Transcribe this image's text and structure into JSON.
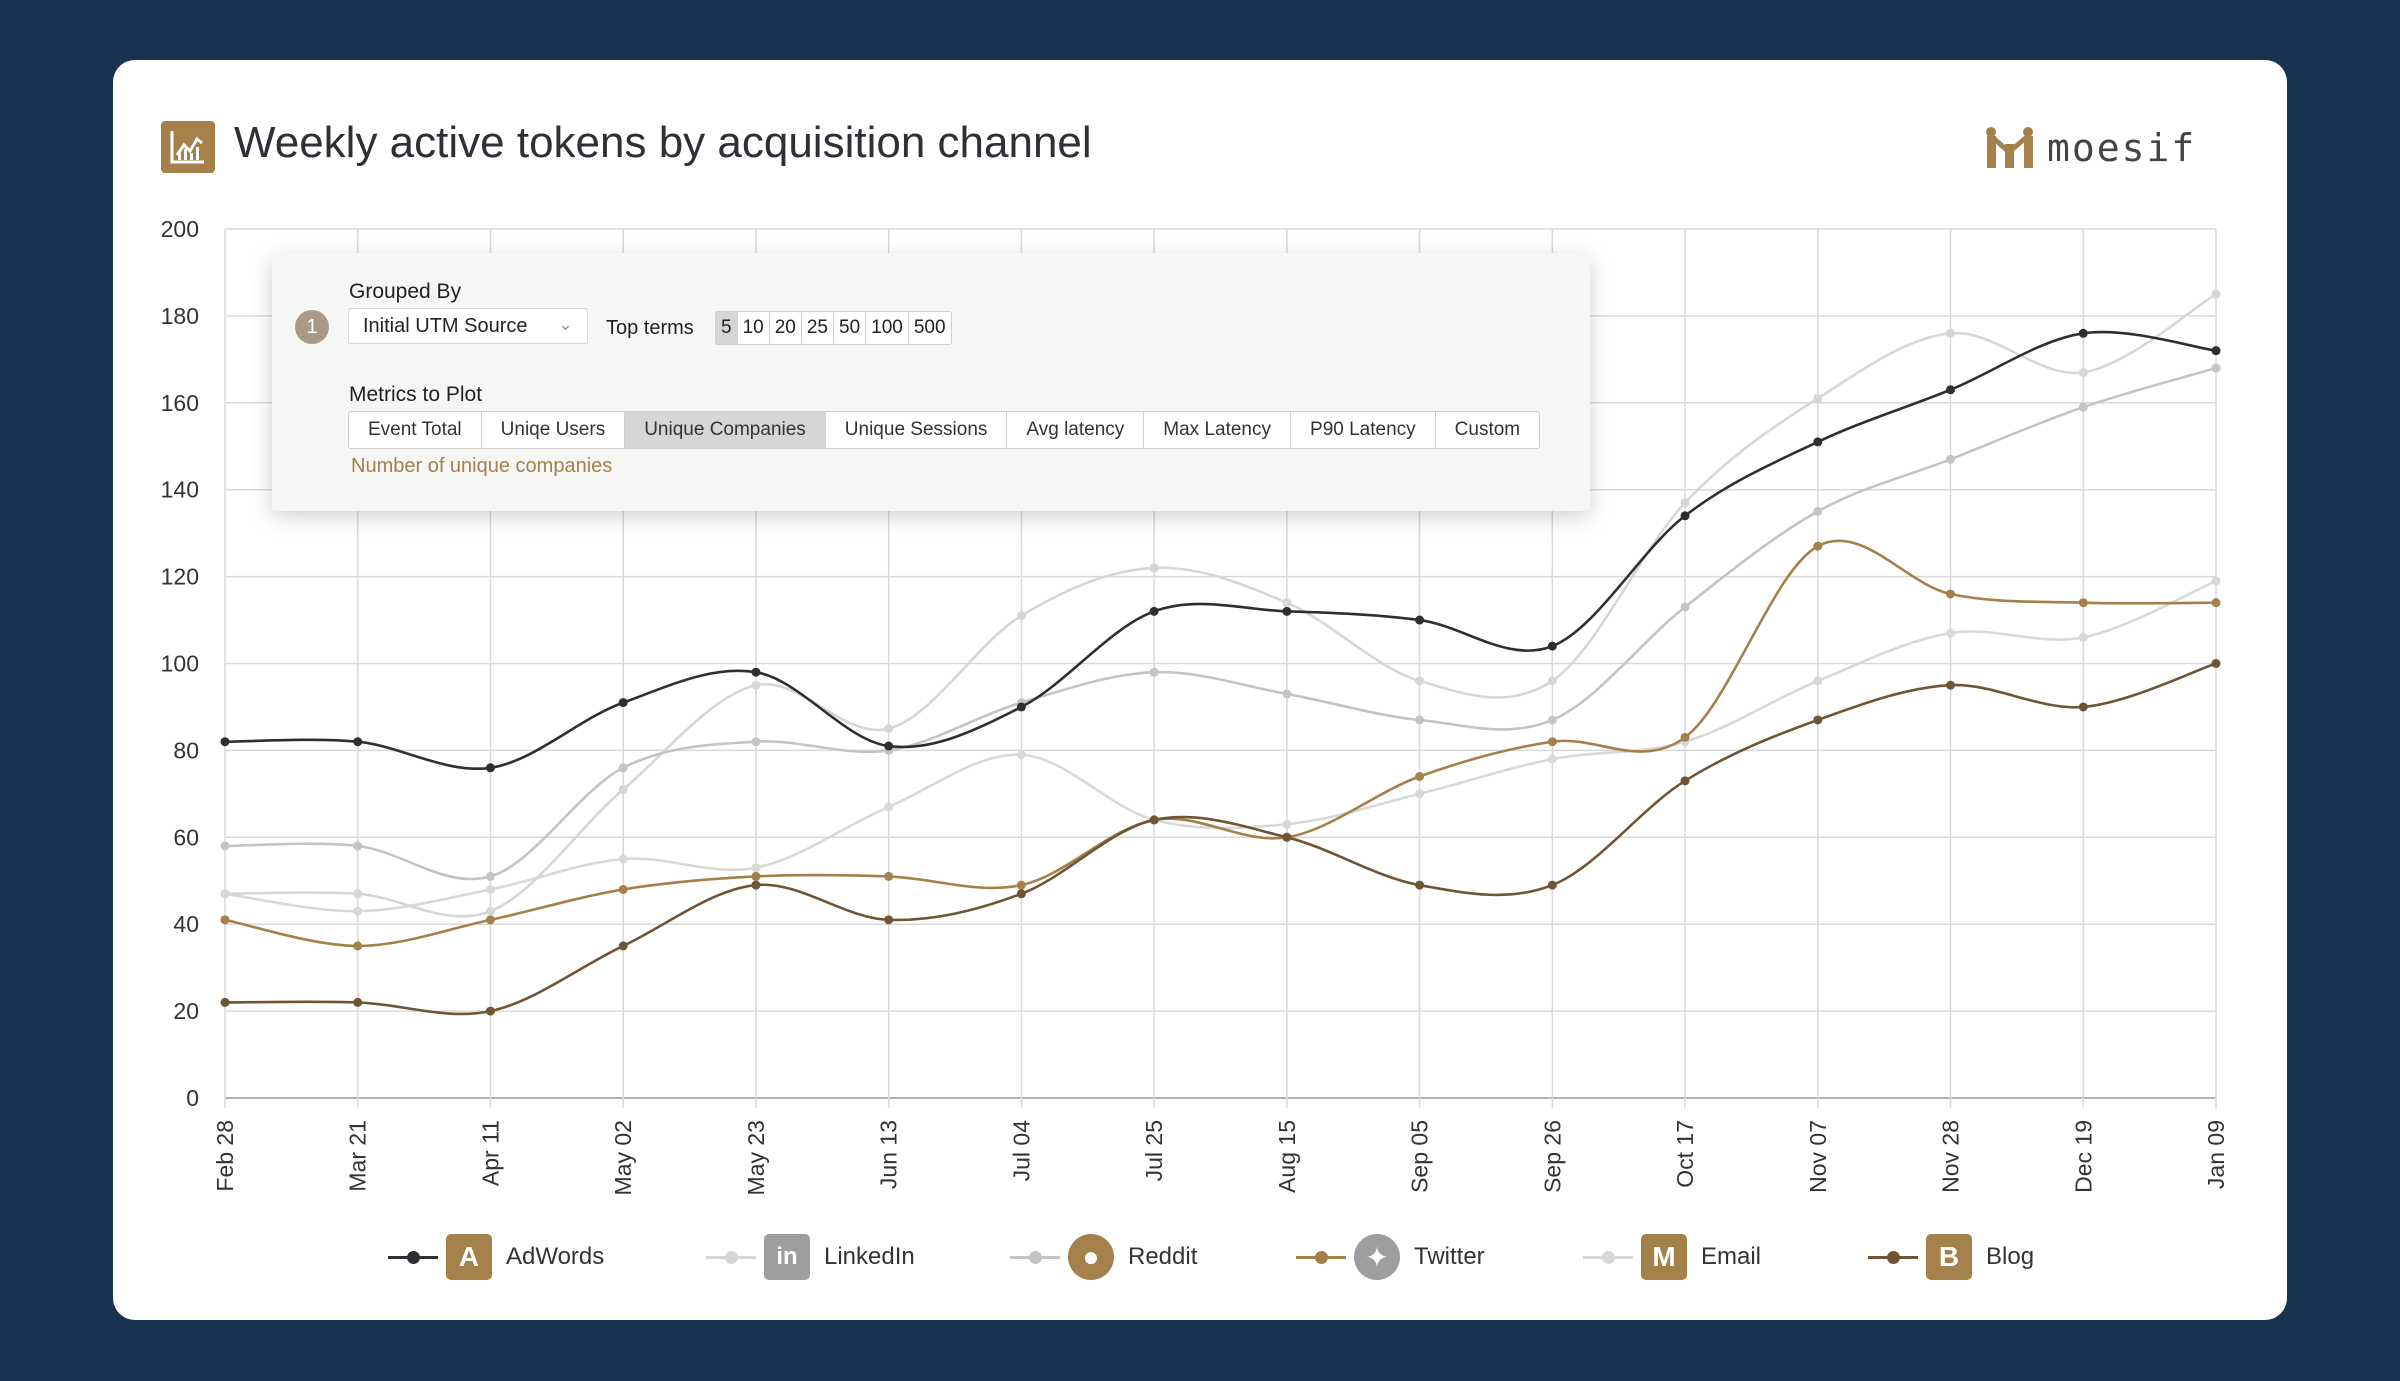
{
  "header": {
    "title": "Weekly active tokens by acquisition channel",
    "brand": "moesif",
    "icon": "chart-icon"
  },
  "panel": {
    "grouped_by_label": "Grouped By",
    "step_number": "1",
    "group_select_value": "Initial UTM Source",
    "top_terms_label": "Top terms",
    "top_terms_options": [
      "5",
      "10",
      "20",
      "25",
      "50",
      "100",
      "500"
    ],
    "top_terms_selected": "5",
    "metrics_label": "Metrics to Plot",
    "metric_tabs": [
      "Event Total",
      "Uniqe Users",
      "Unique Companies",
      "Unique Sessions",
      "Avg latency",
      "Max Latency",
      "P90 Latency",
      "Custom"
    ],
    "metric_selected": "Unique Companies",
    "metric_description": "Number of unique companies"
  },
  "colors": {
    "background": "#16324f",
    "accent": "#a6804a",
    "AdWords": "#2e2e35",
    "LinkedIn": "#d5d7d4",
    "Reddit": "#c3c5c3",
    "Twitter": "#a6804a",
    "Email": "#d7d9d6",
    "Blog": "#6e5535"
  },
  "chart_data": {
    "type": "line",
    "title": "Weekly active tokens by acquisition channel",
    "x": [
      "Feb 28",
      "Mar 21",
      "Apr 11",
      "May 02",
      "May 23",
      "Jun 13",
      "Jul 04",
      "Jul 25",
      "Aug 15",
      "Sep 05",
      "Sep 26",
      "Oct 17",
      "Nov 07",
      "Nov 28",
      "Dec 19",
      "Jan 09"
    ],
    "ylim": [
      0,
      200
    ],
    "yticks": [
      0,
      20,
      40,
      60,
      80,
      100,
      120,
      140,
      160,
      180,
      200
    ],
    "grid": true,
    "legend_position": "bottom",
    "series": [
      {
        "name": "AdWords",
        "icon": "adwords-icon",
        "values": [
          82,
          82,
          76,
          91,
          98,
          81,
          90,
          112,
          112,
          110,
          104,
          134,
          151,
          163,
          176,
          172
        ]
      },
      {
        "name": "LinkedIn",
        "icon": "linkedin-icon",
        "values": [
          47,
          47,
          43,
          71,
          95,
          85,
          111,
          122,
          114,
          96,
          96,
          137,
          161,
          176,
          167,
          185
        ]
      },
      {
        "name": "Reddit",
        "icon": "reddit-icon",
        "values": [
          58,
          58,
          51,
          76,
          82,
          80,
          91,
          98,
          93,
          87,
          87,
          113,
          135,
          147,
          159,
          168
        ]
      },
      {
        "name": "Twitter",
        "icon": "twitter-icon",
        "values": [
          41,
          35,
          41,
          48,
          51,
          51,
          49,
          64,
          60,
          74,
          82,
          83,
          127,
          116,
          114,
          114
        ]
      },
      {
        "name": "Email",
        "icon": "email-icon",
        "values": [
          47,
          43,
          48,
          55,
          53,
          67,
          79,
          64,
          63,
          70,
          78,
          82,
          96,
          107,
          106,
          119
        ]
      },
      {
        "name": "Blog",
        "icon": "blog-icon",
        "values": [
          22,
          22,
          20,
          35,
          49,
          41,
          47,
          64,
          60,
          49,
          49,
          73,
          87,
          95,
          90,
          100
        ]
      }
    ]
  }
}
